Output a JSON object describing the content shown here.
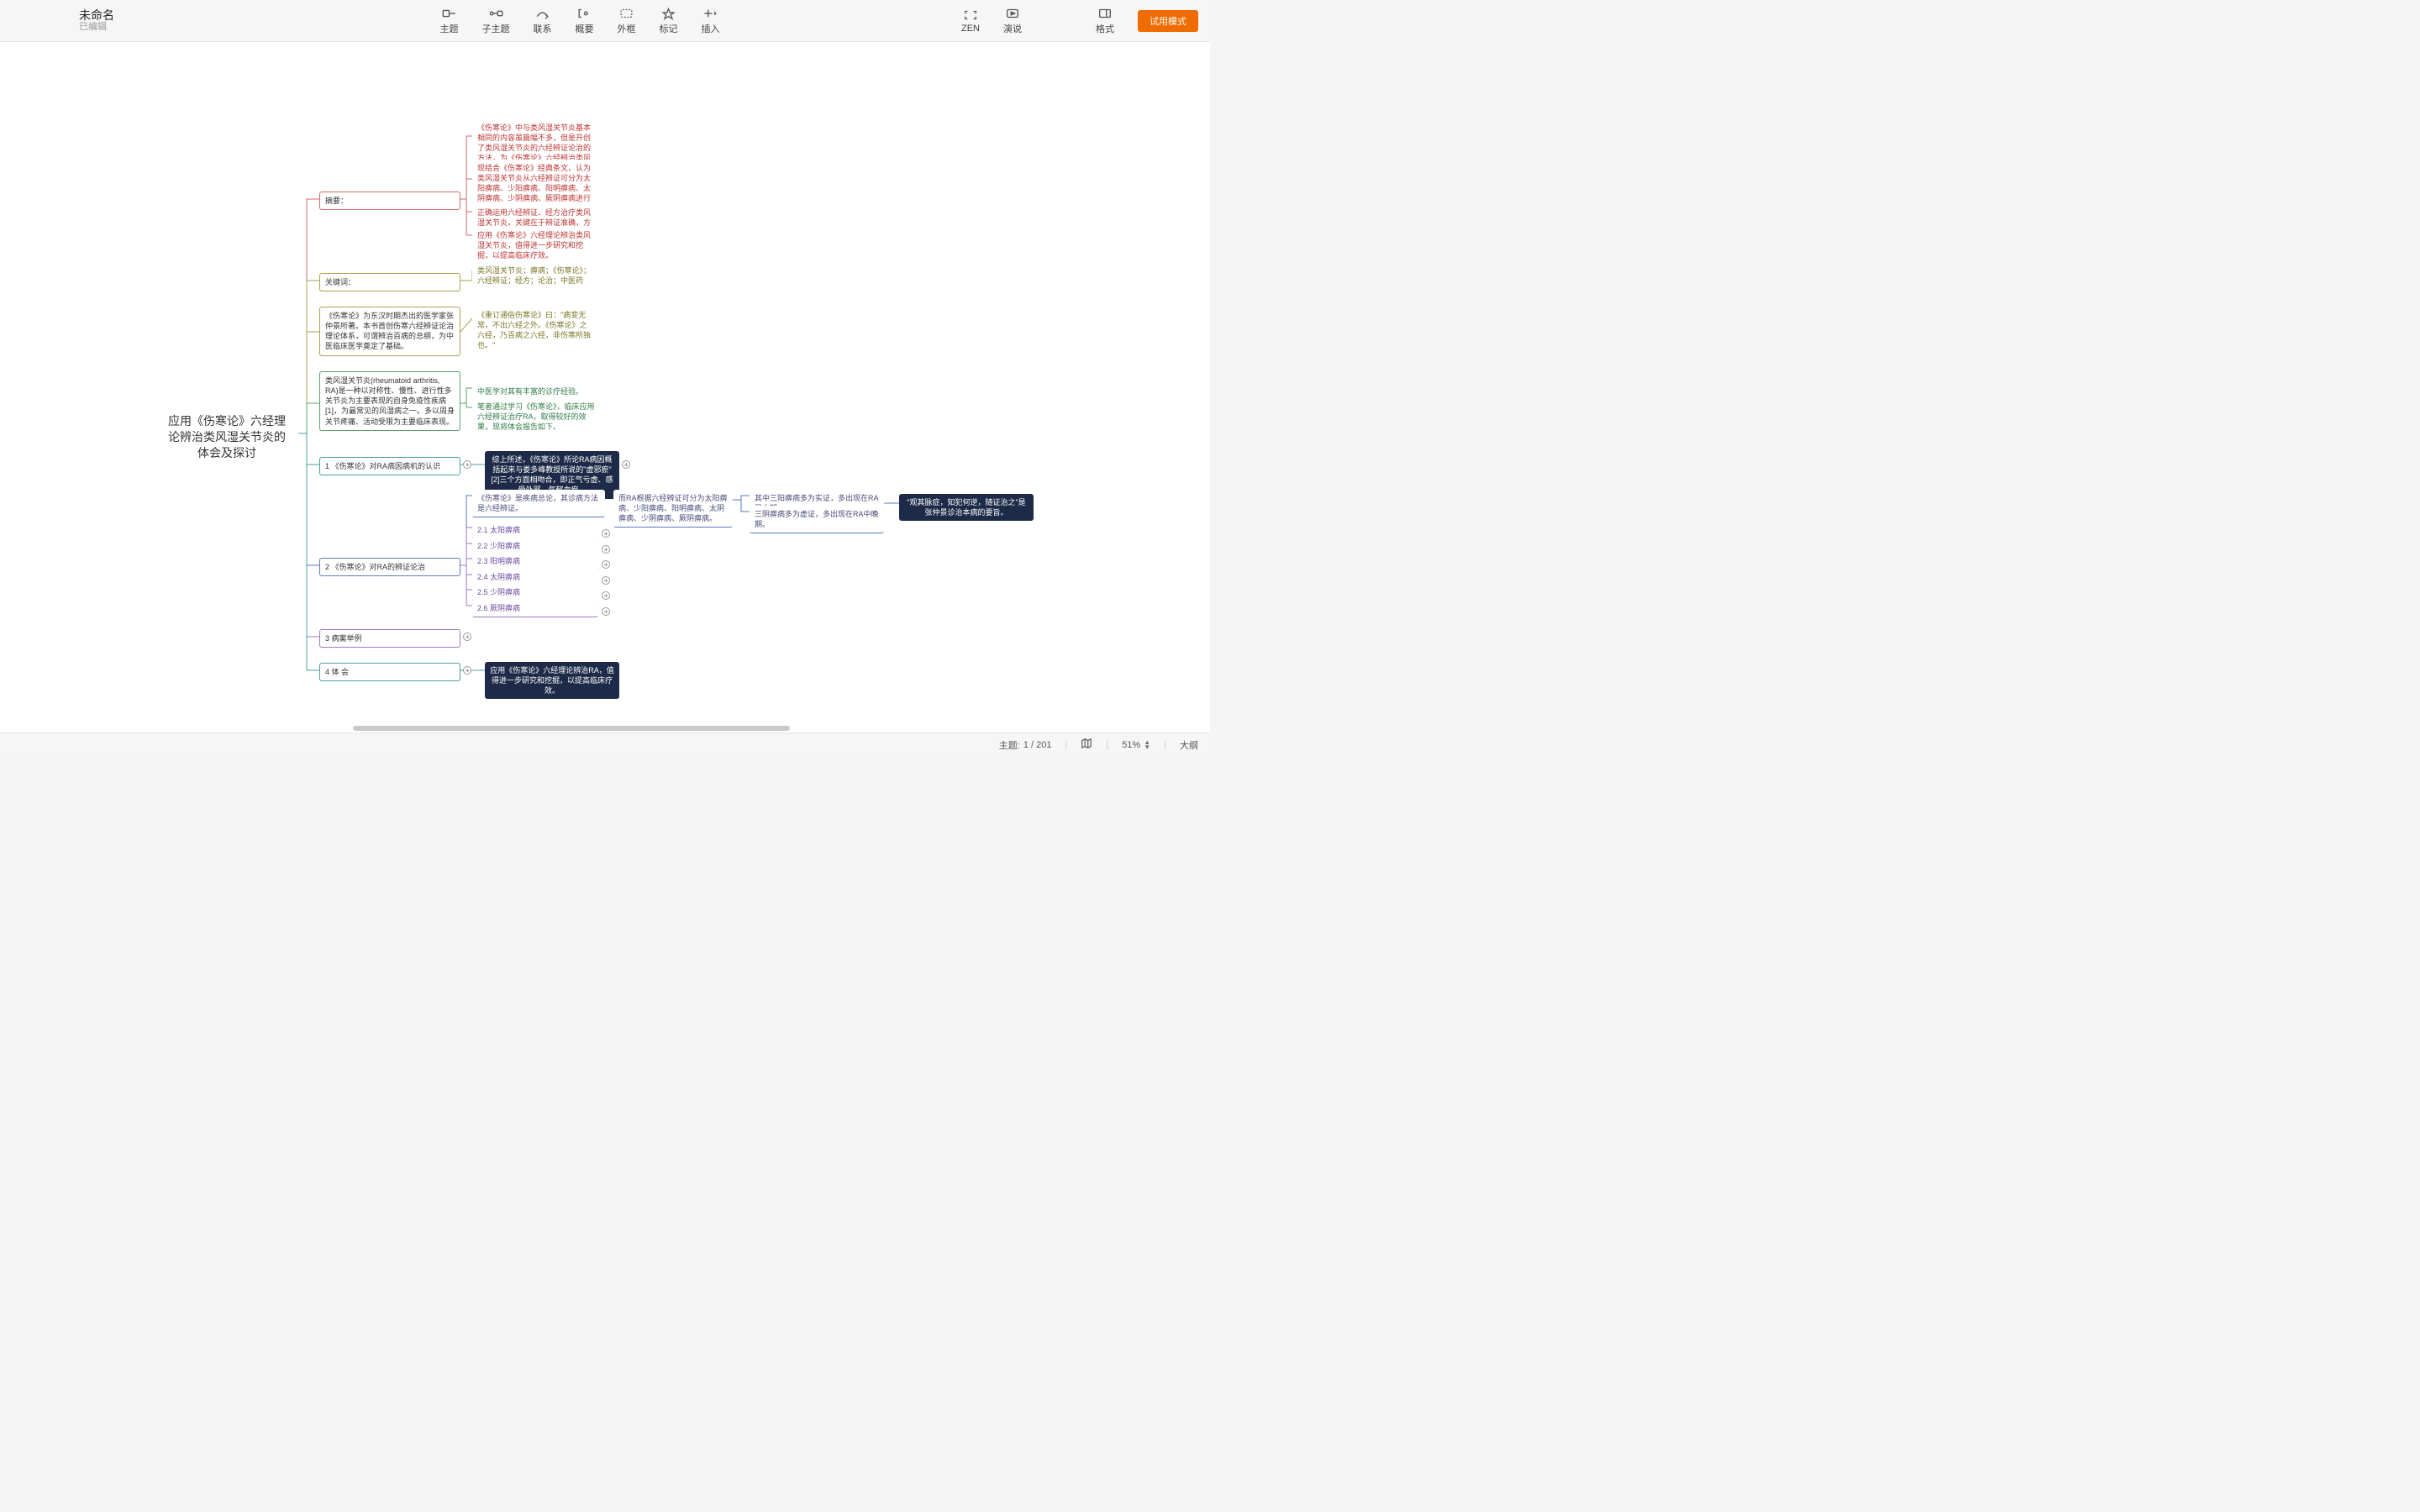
{
  "header": {
    "title": "未命名",
    "subtitle": "已编辑"
  },
  "toolbar": {
    "topic": "主题",
    "subtopic": "子主题",
    "relation": "联系",
    "summary": "概要",
    "boundary": "外框",
    "marker": "标记",
    "insert": "插入",
    "zen": "ZEN",
    "present": "演说",
    "format": "格式",
    "trial": "试用模式"
  },
  "status": {
    "topic_label": "主题:",
    "topic_count": "1 / 201",
    "zoom": "51%",
    "outline": "大纲"
  },
  "central": "应用《伤寒论》六经理论辨治类风湿关节炎的体会及探讨",
  "branches": {
    "abstract": "摘要：",
    "keywords": "关键词：",
    "intro1": "《伤寒论》为东汉时期杰出的医学家张仲景所著。本书首创伤寒六经辨证论治理论体系，可谓辨治百病的总纲，为中医临床医学奠定了基础。",
    "intro2": "类风湿关节炎(rheumatoid arthritis, RA)是一种以对称性、慢性、进行性多关节炎为主要表现的自身免疫性疾病[1]，为最常见的风湿病之一。多以周身关节疼痛、活动受限为主要临床表现。",
    "sec1": "1 《伤寒论》对RA病因病机的认识",
    "sec2": "2 《伤寒论》对RA的辨证论治",
    "sec3": "3 病案举例",
    "sec4": "4 体 会"
  },
  "abstract_items": [
    "《伤寒论》中与类风湿关节炎基本相同的内容虽篇幅不多，但是开创了类风湿关节炎的六经辨证论治的方法，为《伤寒论》六经辨治类风湿关节炎奠定了基础。",
    "现结合《伤寒论》经典条文，认为类风湿关节炎从六经辨证可分为太阳痹病、少阳痹病、阳明痹病、太阴痹病、少阴痹病、厥阴痹病进行论治。先辨六经，继辨方证，为类风湿关节炎的中医治疗提供新思路。",
    "正确运用六经辨证、经方治疗类风湿关节炎，关键在于辨证准确，方证相对。",
    "应用《伤寒论》六经理论辨治类风湿关节炎，值得进一步研究和挖掘，以提高临床疗效。"
  ],
  "keywords_text": "类风湿关节炎；痹病；《伤寒论》；六经辨证；经方；论治；中医药",
  "olive_quote": "《重订通俗伤寒论》曰：\"病变无常，不出六经之外。《伤寒论》之六经，乃百病之六经，非伤寒所独也。\"",
  "green_items": [
    "中医学对其有丰富的诊疗经验。",
    "笔者通过学习《伤寒论》，临床应用六经辨证治疗RA，取得较好的效果，现将体会报告如下。"
  ],
  "sec1_dark": "综上所述，《伤寒论》所论RA病因概括起来与娄多峰教授所说的\"虚邪瘀\"[2]三个方面相吻合，即正气亏虚、感受外邪、气郁血瘀。",
  "sec2_lead": "《伤寒论》是疾病总论，其诊病方法是六经辨证。",
  "sec2_r1": "而RA根据六经辨证可分为太阳痹病、少阳痹病、阳明痹病、太阴痹病、少阴痹病、厥阴痹病。",
  "sec2_r2a": "其中三阳痹病多为实证，多出现在RA早中期；",
  "sec2_r2b": "三阴痹病多为虚证，多出现在RA中晚期。",
  "sec2_dark": "\"观其脉症，知犯何逆，随证治之\"是张仲景诊治本病的要旨。",
  "sec2_items": [
    "2.1 太阳痹病",
    "2.2 少阳痹病",
    "2.3 阳明痹病",
    "2.4 太阴痹病",
    "2.5 少阴痹病",
    "2.6 厥阴痹病"
  ],
  "sec4_dark": "应用《伤寒论》六经理论辨治RA，值得进一步研究和挖掘，以提高临床疗效。"
}
